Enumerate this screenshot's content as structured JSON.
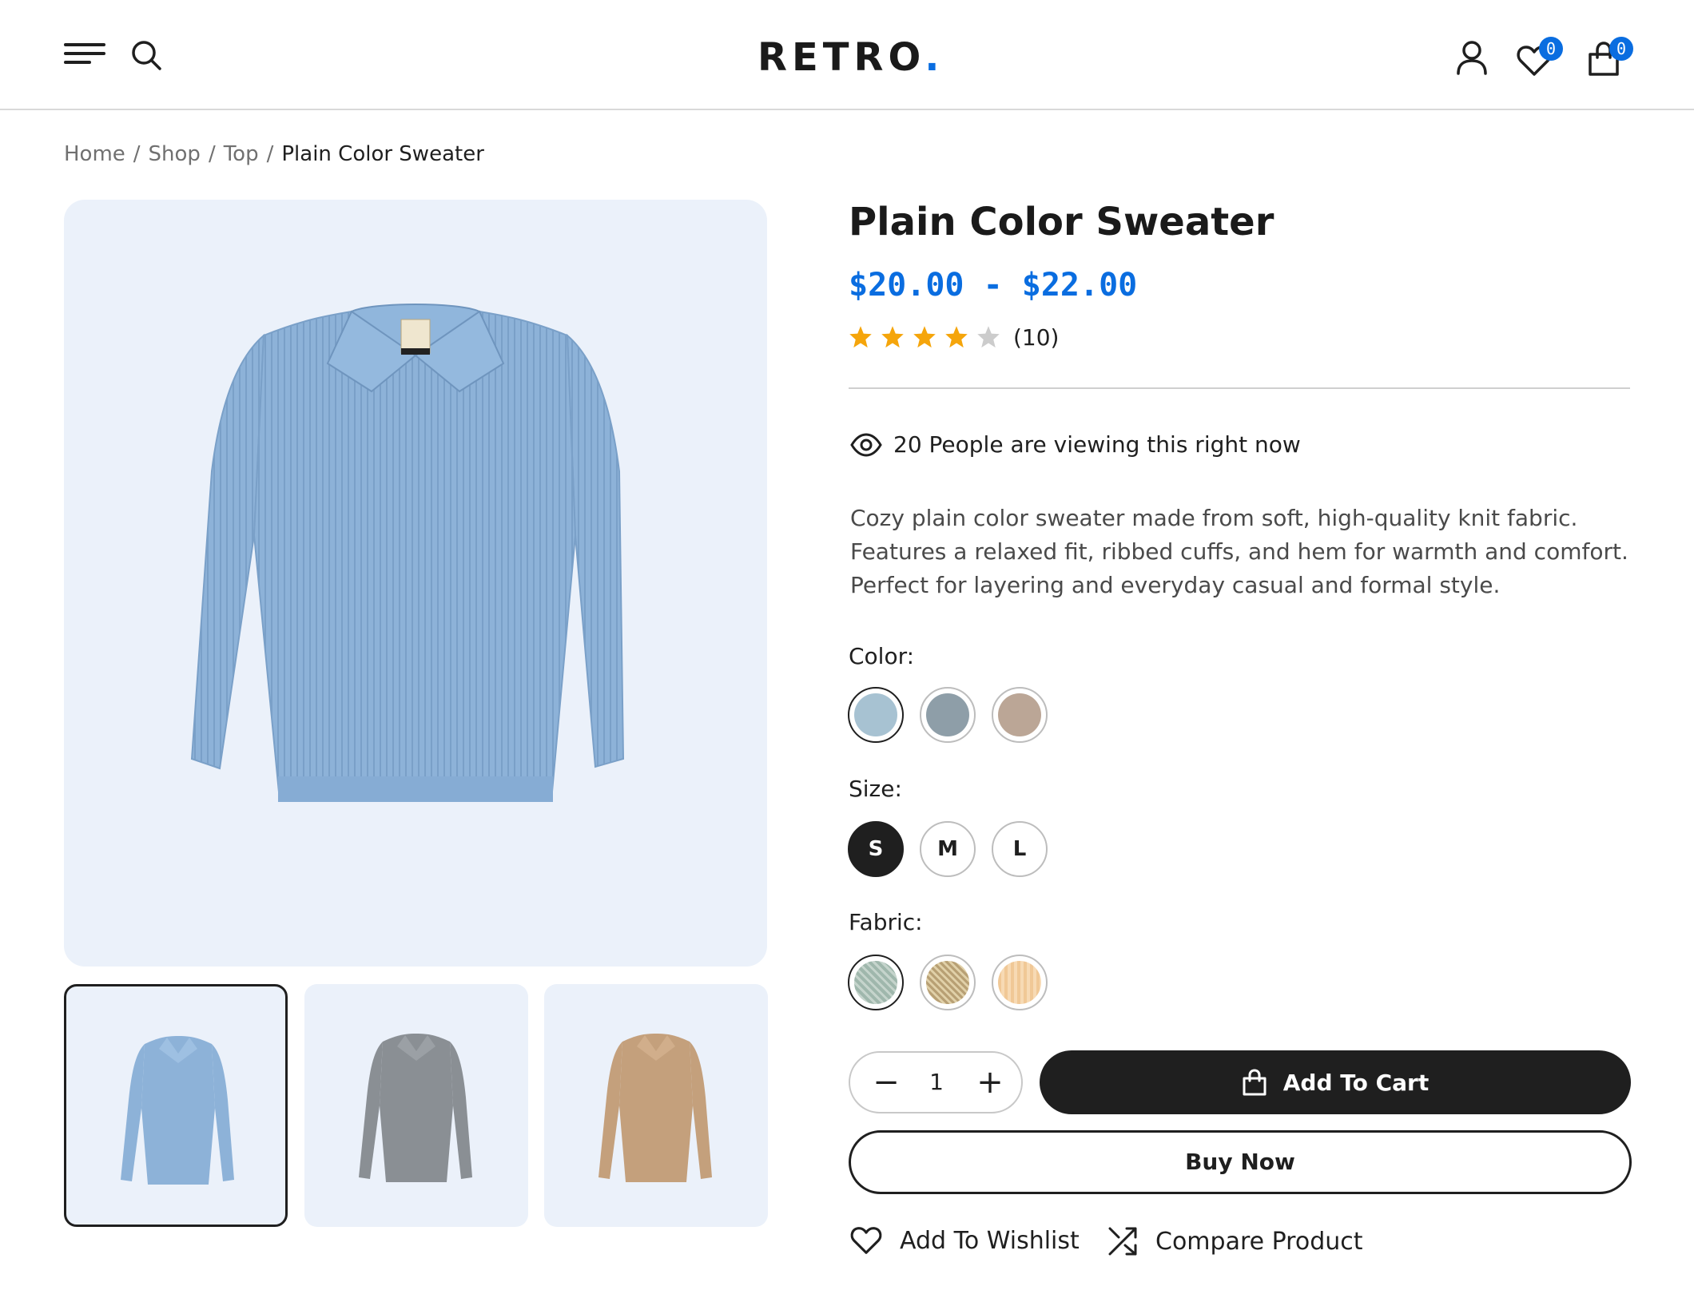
{
  "header": {
    "logo_text": "RETRO",
    "logo_dot": ".",
    "wishlist_count": "0",
    "cart_count": "0",
    "icons": [
      "menu-icon",
      "search-icon",
      "user-icon",
      "heart-icon",
      "shopping-bag-icon"
    ],
    "accent_color": "#0a6de0"
  },
  "breadcrumb": {
    "items": [
      "Home",
      "Shop",
      "Top"
    ],
    "separator": "/",
    "current": "Plain Color Sweater"
  },
  "product": {
    "title": "Plain Color Sweater",
    "price": "$20.00 - $22.00",
    "rating": 4,
    "rating_max": 5,
    "rating_count": "(10)",
    "viewing": "20 People are viewing this right now",
    "description_lines": [
      "Cozy plain color sweater made from soft, high-quality knit fabric.",
      "Features a relaxed fit, ribbed cuffs, and hem for warmth and comfort.",
      "Perfect for layering and everyday casual and formal style."
    ]
  },
  "gallery": {
    "thumbnails": [
      {
        "color": "#8db2d8",
        "active": true
      },
      {
        "color": "#8a8f94",
        "active": false
      },
      {
        "color": "#c4a07c",
        "active": false
      }
    ]
  },
  "options": {
    "color_label": "Color:",
    "colors": [
      "#a7c2d2",
      "#8e9ea8",
      "#bba696"
    ],
    "selected_color": 0,
    "size_label": "Size:",
    "sizes": [
      "S",
      "M",
      "L"
    ],
    "selected_size": 0,
    "fabric_label": "Fabric:",
    "fabrics": [
      "#9fb7ac",
      "#b8a074",
      "#f0c896"
    ],
    "selected_fabric": 0
  },
  "purchase": {
    "quantity": "1",
    "minus": "−",
    "plus": "+",
    "add_to_cart": "Add To Cart",
    "buy_now": "Buy Now",
    "add_to_wishlist": "Add To Wishlist",
    "compare": "Compare Product"
  }
}
